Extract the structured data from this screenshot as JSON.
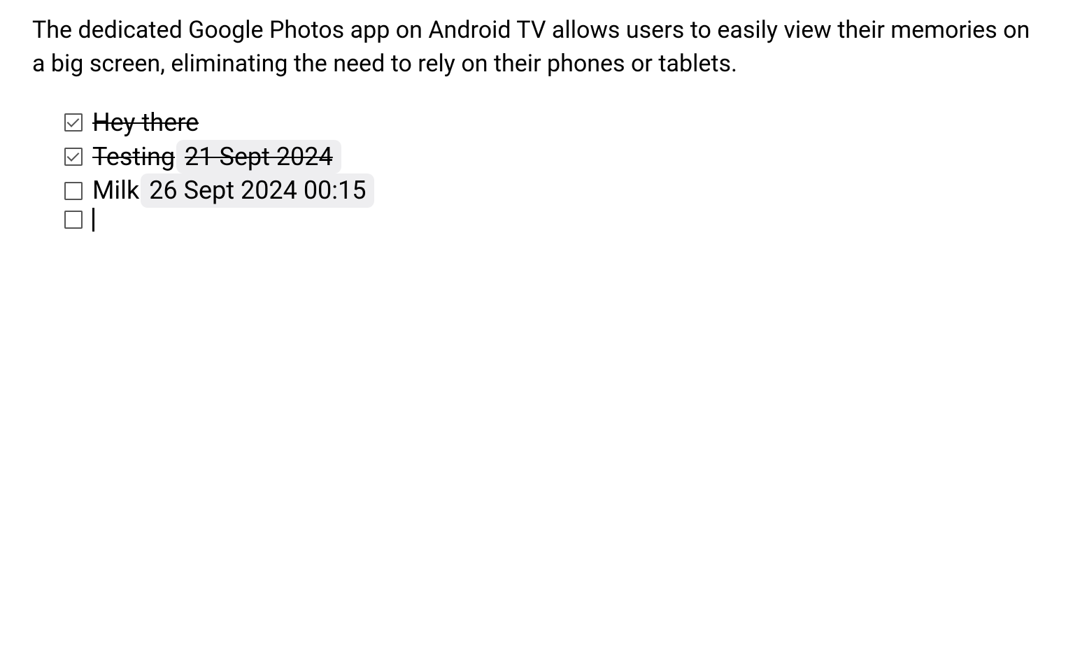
{
  "paragraph": "The dedicated Google Photos app on Android TV allows users to easily view their memories on a big screen, eliminating the need to rely on their phones or tablets.",
  "todos": [
    {
      "checked": true,
      "text": "Hey there",
      "date": ""
    },
    {
      "checked": true,
      "text": "Testing",
      "date": "21 Sept 2024"
    },
    {
      "checked": false,
      "text": "Milk",
      "date": "26 Sept 2024 00:15"
    },
    {
      "checked": false,
      "text": "",
      "date": ""
    }
  ]
}
